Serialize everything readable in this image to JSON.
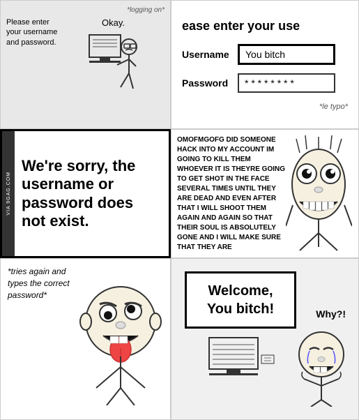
{
  "cell1": {
    "logging_on": "*logging on*",
    "please_text": "Please enter your username and password.",
    "okay": "Okay."
  },
  "cell2": {
    "title": "ease enter your use",
    "username_label": "Username",
    "username_value": "You bitch",
    "password_label": "Password",
    "password_value": "* * * * * * * *",
    "note": "*le typo*"
  },
  "cell3": {
    "watermark": "VIA 9GAG.COM",
    "error_message": "We're sorry, the username or password does not exist."
  },
  "cell4": {
    "rage_text": "OMOFMGOFG DID SOMEONE HACK INTO MY ACCOUNT IM GOING TO KILL THEM WHOEVER IT IS THEYRE GOING TO GET SHOT IN THE FACE SEVERAL TIMES UNTIL THEY ARE DEAD AND EVEN AFTER THAT I WILL SHOOT THEM AGAIN AND AGAIN SO THAT THEIR SOUL IS ABSOLUTELY GONE AND I WILL MAKE SURE THAT THEY ARE"
  },
  "cell5": {
    "tries_text": "*tries again and types the correct password*"
  },
  "cell6": {
    "welcome_line1": "Welcome,",
    "welcome_line2": "You bitch!",
    "why": "Why?!"
  }
}
